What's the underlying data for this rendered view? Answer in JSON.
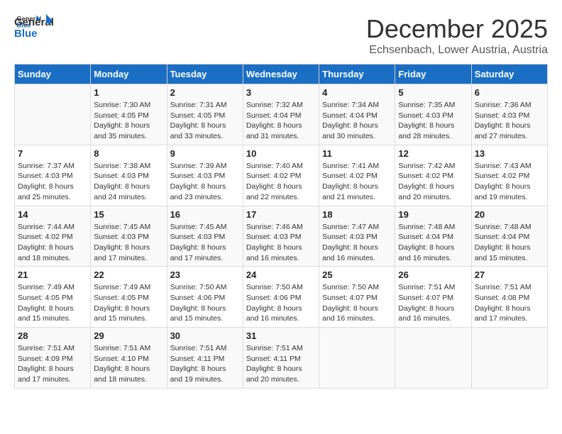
{
  "logo": {
    "line1": "General",
    "line2": "Blue"
  },
  "header": {
    "month": "December 2025",
    "location": "Echsenbach, Lower Austria, Austria"
  },
  "weekdays": [
    "Sunday",
    "Monday",
    "Tuesday",
    "Wednesday",
    "Thursday",
    "Friday",
    "Saturday"
  ],
  "weeks": [
    [
      {
        "day": "",
        "sunrise": "",
        "sunset": "",
        "daylight": ""
      },
      {
        "day": "1",
        "sunrise": "Sunrise: 7:30 AM",
        "sunset": "Sunset: 4:05 PM",
        "daylight": "Daylight: 8 hours and 35 minutes."
      },
      {
        "day": "2",
        "sunrise": "Sunrise: 7:31 AM",
        "sunset": "Sunset: 4:05 PM",
        "daylight": "Daylight: 8 hours and 33 minutes."
      },
      {
        "day": "3",
        "sunrise": "Sunrise: 7:32 AM",
        "sunset": "Sunset: 4:04 PM",
        "daylight": "Daylight: 8 hours and 31 minutes."
      },
      {
        "day": "4",
        "sunrise": "Sunrise: 7:34 AM",
        "sunset": "Sunset: 4:04 PM",
        "daylight": "Daylight: 8 hours and 30 minutes."
      },
      {
        "day": "5",
        "sunrise": "Sunrise: 7:35 AM",
        "sunset": "Sunset: 4:03 PM",
        "daylight": "Daylight: 8 hours and 28 minutes."
      },
      {
        "day": "6",
        "sunrise": "Sunrise: 7:36 AM",
        "sunset": "Sunset: 4:03 PM",
        "daylight": "Daylight: 8 hours and 27 minutes."
      }
    ],
    [
      {
        "day": "7",
        "sunrise": "Sunrise: 7:37 AM",
        "sunset": "Sunset: 4:03 PM",
        "daylight": "Daylight: 8 hours and 25 minutes."
      },
      {
        "day": "8",
        "sunrise": "Sunrise: 7:38 AM",
        "sunset": "Sunset: 4:03 PM",
        "daylight": "Daylight: 8 hours and 24 minutes."
      },
      {
        "day": "9",
        "sunrise": "Sunrise: 7:39 AM",
        "sunset": "Sunset: 4:03 PM",
        "daylight": "Daylight: 8 hours and 23 minutes."
      },
      {
        "day": "10",
        "sunrise": "Sunrise: 7:40 AM",
        "sunset": "Sunset: 4:02 PM",
        "daylight": "Daylight: 8 hours and 22 minutes."
      },
      {
        "day": "11",
        "sunrise": "Sunrise: 7:41 AM",
        "sunset": "Sunset: 4:02 PM",
        "daylight": "Daylight: 8 hours and 21 minutes."
      },
      {
        "day": "12",
        "sunrise": "Sunrise: 7:42 AM",
        "sunset": "Sunset: 4:02 PM",
        "daylight": "Daylight: 8 hours and 20 minutes."
      },
      {
        "day": "13",
        "sunrise": "Sunrise: 7:43 AM",
        "sunset": "Sunset: 4:02 PM",
        "daylight": "Daylight: 8 hours and 19 minutes."
      }
    ],
    [
      {
        "day": "14",
        "sunrise": "Sunrise: 7:44 AM",
        "sunset": "Sunset: 4:02 PM",
        "daylight": "Daylight: 8 hours and 18 minutes."
      },
      {
        "day": "15",
        "sunrise": "Sunrise: 7:45 AM",
        "sunset": "Sunset: 4:03 PM",
        "daylight": "Daylight: 8 hours and 17 minutes."
      },
      {
        "day": "16",
        "sunrise": "Sunrise: 7:45 AM",
        "sunset": "Sunset: 4:03 PM",
        "daylight": "Daylight: 8 hours and 17 minutes."
      },
      {
        "day": "17",
        "sunrise": "Sunrise: 7:46 AM",
        "sunset": "Sunset: 4:03 PM",
        "daylight": "Daylight: 8 hours and 16 minutes."
      },
      {
        "day": "18",
        "sunrise": "Sunrise: 7:47 AM",
        "sunset": "Sunset: 4:03 PM",
        "daylight": "Daylight: 8 hours and 16 minutes."
      },
      {
        "day": "19",
        "sunrise": "Sunrise: 7:48 AM",
        "sunset": "Sunset: 4:04 PM",
        "daylight": "Daylight: 8 hours and 16 minutes."
      },
      {
        "day": "20",
        "sunrise": "Sunrise: 7:48 AM",
        "sunset": "Sunset: 4:04 PM",
        "daylight": "Daylight: 8 hours and 15 minutes."
      }
    ],
    [
      {
        "day": "21",
        "sunrise": "Sunrise: 7:49 AM",
        "sunset": "Sunset: 4:05 PM",
        "daylight": "Daylight: 8 hours and 15 minutes."
      },
      {
        "day": "22",
        "sunrise": "Sunrise: 7:49 AM",
        "sunset": "Sunset: 4:05 PM",
        "daylight": "Daylight: 8 hours and 15 minutes."
      },
      {
        "day": "23",
        "sunrise": "Sunrise: 7:50 AM",
        "sunset": "Sunset: 4:06 PM",
        "daylight": "Daylight: 8 hours and 15 minutes."
      },
      {
        "day": "24",
        "sunrise": "Sunrise: 7:50 AM",
        "sunset": "Sunset: 4:06 PM",
        "daylight": "Daylight: 8 hours and 16 minutes."
      },
      {
        "day": "25",
        "sunrise": "Sunrise: 7:50 AM",
        "sunset": "Sunset: 4:07 PM",
        "daylight": "Daylight: 8 hours and 16 minutes."
      },
      {
        "day": "26",
        "sunrise": "Sunrise: 7:51 AM",
        "sunset": "Sunset: 4:07 PM",
        "daylight": "Daylight: 8 hours and 16 minutes."
      },
      {
        "day": "27",
        "sunrise": "Sunrise: 7:51 AM",
        "sunset": "Sunset: 4:08 PM",
        "daylight": "Daylight: 8 hours and 17 minutes."
      }
    ],
    [
      {
        "day": "28",
        "sunrise": "Sunrise: 7:51 AM",
        "sunset": "Sunset: 4:09 PM",
        "daylight": "Daylight: 8 hours and 17 minutes."
      },
      {
        "day": "29",
        "sunrise": "Sunrise: 7:51 AM",
        "sunset": "Sunset: 4:10 PM",
        "daylight": "Daylight: 8 hours and 18 minutes."
      },
      {
        "day": "30",
        "sunrise": "Sunrise: 7:51 AM",
        "sunset": "Sunset: 4:11 PM",
        "daylight": "Daylight: 8 hours and 19 minutes."
      },
      {
        "day": "31",
        "sunrise": "Sunrise: 7:51 AM",
        "sunset": "Sunset: 4:11 PM",
        "daylight": "Daylight: 8 hours and 20 minutes."
      },
      {
        "day": "",
        "sunrise": "",
        "sunset": "",
        "daylight": ""
      },
      {
        "day": "",
        "sunrise": "",
        "sunset": "",
        "daylight": ""
      },
      {
        "day": "",
        "sunrise": "",
        "sunset": "",
        "daylight": ""
      }
    ]
  ]
}
